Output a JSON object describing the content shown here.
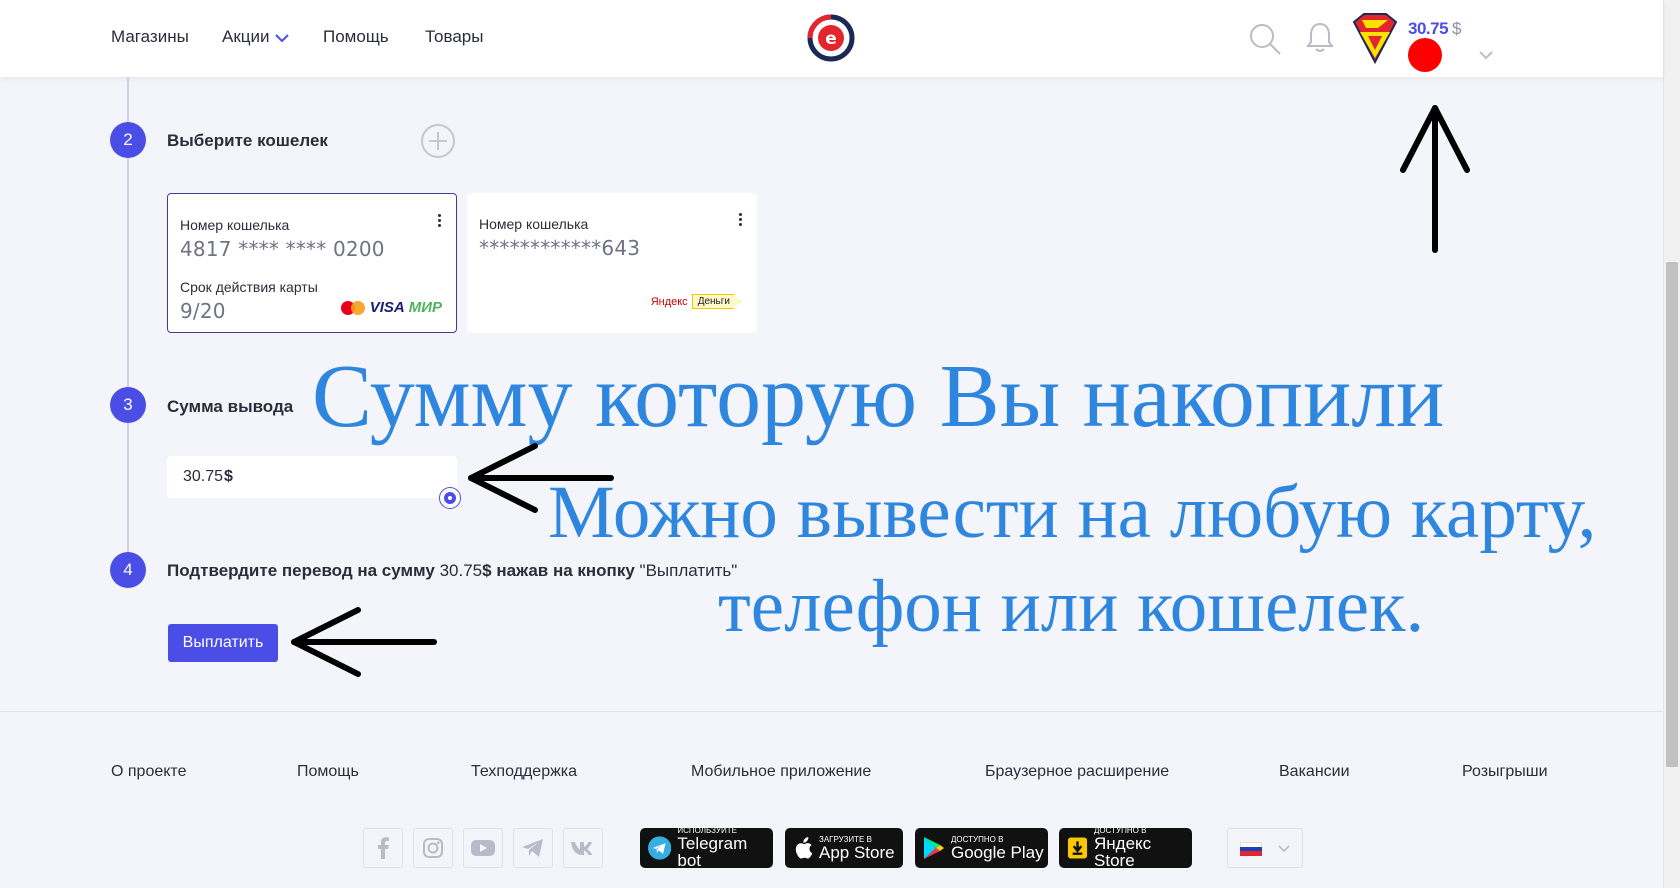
{
  "header": {
    "nav": [
      {
        "label": "Магазины"
      },
      {
        "label": "Акции"
      },
      {
        "label": "Помощь"
      },
      {
        "label": "Товары"
      }
    ],
    "balance": "30.75",
    "currency": "$"
  },
  "steps": {
    "wallet": {
      "number": "2",
      "title": "Выберите кошелек"
    },
    "amount": {
      "number": "3",
      "title": "Сумма вывода"
    },
    "confirm": {
      "number": "4",
      "text_before": "Подтвердите перевод на сумму",
      "amount": "30.75",
      "currency": "$",
      "text_after": "нажав на кнопку",
      "button_ref": "\"Выплатить\""
    }
  },
  "wallets": [
    {
      "number_label": "Номер кошелька",
      "number": "4817 **** **** 0200",
      "expiry_label": "Срок действия карты",
      "expiry": "9/20",
      "brands": [
        "VISA",
        "МИР"
      ]
    },
    {
      "number_label": "Номер кошелька",
      "number": "************643",
      "brand_name": "Яндекс",
      "brand_tag": "Деньги"
    }
  ],
  "amount_input": {
    "value": "30.75",
    "currency": "$"
  },
  "pay_button": "Выплатить",
  "annotations": {
    "line1": "Сумму которую Вы накопили",
    "line2": "Можно вывести на любую карту,",
    "line3": "телефон или кошелек."
  },
  "footer": {
    "links": [
      "О проекте",
      "Помощь",
      "Техподдержка",
      "Мобильное приложение",
      "Браузерное расширение",
      "Вакансии",
      "Розыгрыши"
    ],
    "socials": [
      "facebook-icon",
      "instagram-icon",
      "youtube-icon",
      "telegram-icon",
      "vk-icon"
    ],
    "stores": [
      {
        "small": "Используйте",
        "big": "Telegram bot"
      },
      {
        "small": "Загрузите в",
        "big": "App Store"
      },
      {
        "small": "Доступно в",
        "big": "Google Play"
      },
      {
        "small": "Доступно в",
        "big": "Яндекс Store"
      }
    ]
  },
  "colors": {
    "accent": "#4a4de6",
    "annotation": "#2e86de",
    "alert": "#ff0000"
  }
}
